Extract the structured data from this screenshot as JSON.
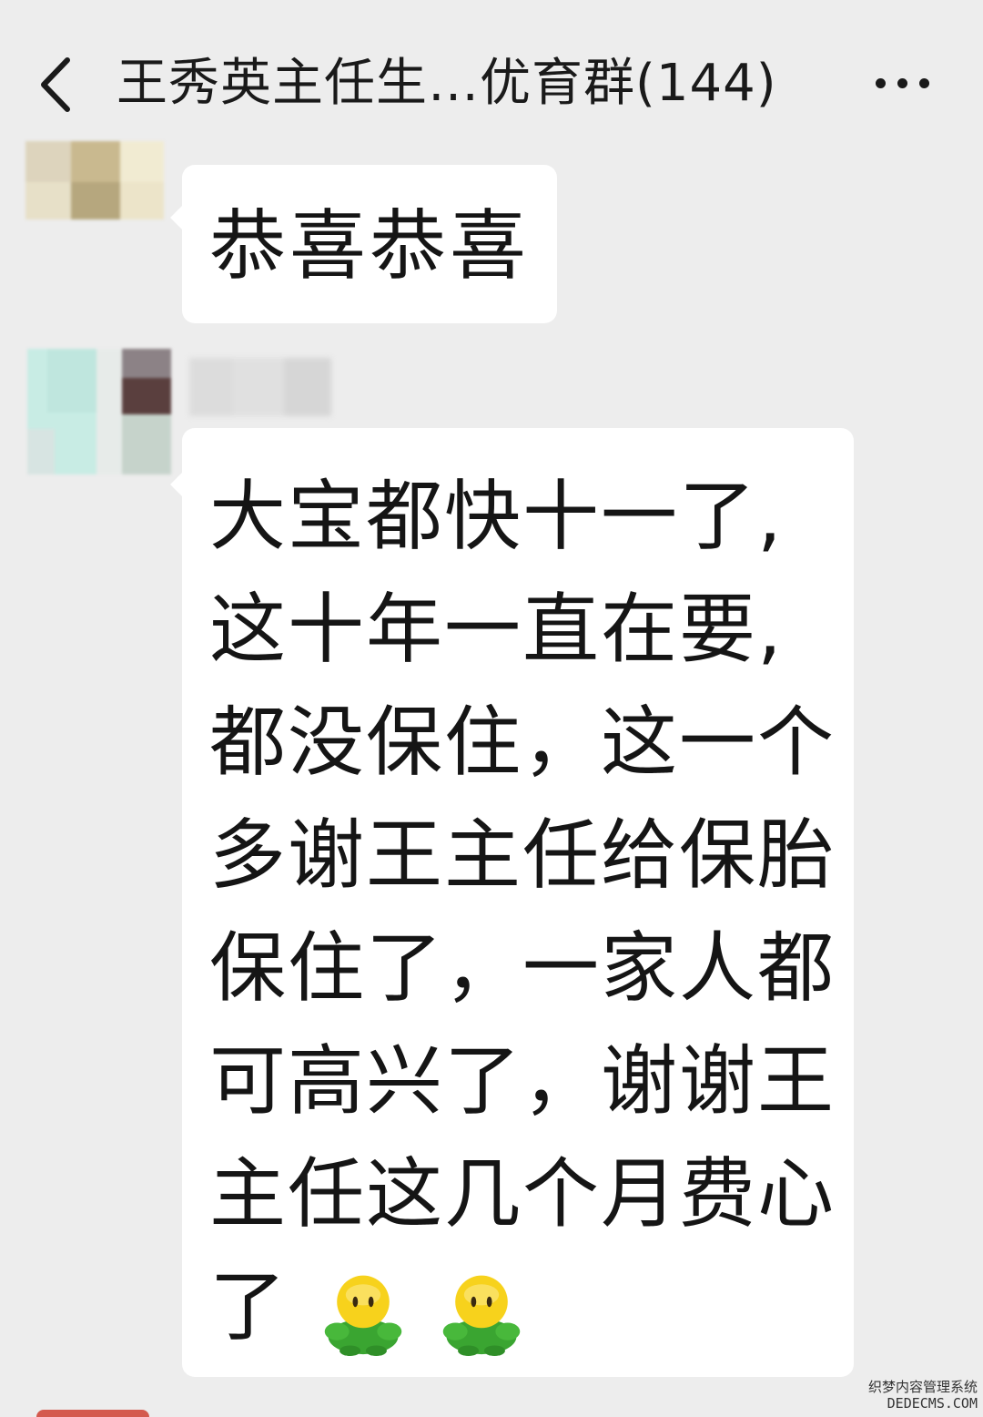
{
  "header": {
    "back_icon": "chevron-left-icon",
    "title": "王秀英主任生…优育群(144)",
    "more_icon": "more-dots-icon"
  },
  "messages": [
    {
      "sender_avatar": "pixelated-avatar",
      "text": "恭喜恭喜"
    },
    {
      "sender_avatar": "pixelated-avatar",
      "sender_name_obscured": true,
      "lines": [
        "大宝都快十一了,",
        "这十年一直在要,",
        "都没保住，这一个",
        "多谢王主任给保胎",
        "保住了，一家人都",
        "可高兴了，谢谢王",
        "主任这几个月费心",
        "了"
      ],
      "trailing_emoji": [
        "green-turtle-emoji",
        "green-turtle-emoji"
      ]
    }
  ],
  "watermark": {
    "line1": "织梦内容管理系统",
    "line2": "DEDECMS.COM"
  },
  "colors": {
    "background": "#ededed",
    "bubble": "#ffffff",
    "text": "#151515"
  }
}
